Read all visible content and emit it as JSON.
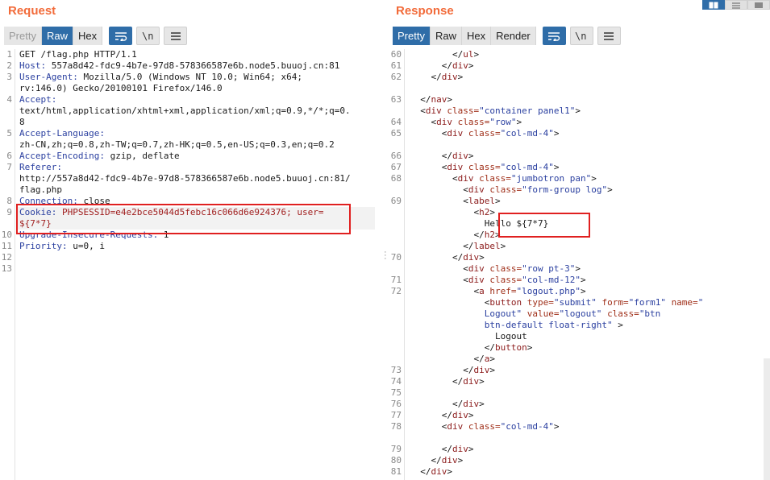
{
  "request": {
    "title": "Request",
    "tabs": [
      "Pretty",
      "Raw",
      "Hex"
    ],
    "active_tab": "Raw",
    "lines": [
      {
        "n": "1",
        "text": "GET /flag.php HTTP/1.1"
      },
      {
        "n": "2",
        "key": "Host:",
        "val": " 557a8d42-fdc9-4b7e-97d8-578366587e6b.node5.buuoj.cn:81"
      },
      {
        "n": "3",
        "key": "User-Agent:",
        "val": " Mozilla/5.0 (Windows NT 10.0; Win64; x64;"
      },
      {
        "n": "",
        "text": "rv:146.0) Gecko/20100101 Firefox/146.0"
      },
      {
        "n": "4",
        "key": "Accept:",
        "val": ""
      },
      {
        "n": "",
        "text": "text/html,application/xhtml+xml,application/xml;q=0.9,*/*;q=0."
      },
      {
        "n": "",
        "text": "8"
      },
      {
        "n": "5",
        "key": "Accept-Language:",
        "val": ""
      },
      {
        "n": "",
        "text": "zh-CN,zh;q=0.8,zh-TW;q=0.7,zh-HK;q=0.5,en-US;q=0.3,en;q=0.2"
      },
      {
        "n": "6",
        "key": "Accept-Encoding:",
        "val": " gzip, deflate"
      },
      {
        "n": "7",
        "key": "Referer:",
        "val": ""
      },
      {
        "n": "",
        "text": "http://557a8d42-fdc9-4b7e-97d8-578366587e6b.node5.buuoj.cn:81/"
      },
      {
        "n": "",
        "text": "flag.php"
      },
      {
        "n": "8",
        "key": "Connection:",
        "val": " close"
      },
      {
        "n": "9",
        "key": "Cookie:",
        "val": " PHPSESSID=e4e2bce5044d5febc16c066d6e924376; user="
      },
      {
        "n": "",
        "text": "${7*7}",
        "cls": "v"
      },
      {
        "n": "10",
        "key": "Upgrade-Insecure-Requests:",
        "val": " 1"
      },
      {
        "n": "11",
        "key": "Priority:",
        "val": " u=0, i"
      },
      {
        "n": "12",
        "text": ""
      },
      {
        "n": "13",
        "text": ""
      }
    ]
  },
  "response": {
    "title": "Response",
    "tabs": [
      "Pretty",
      "Raw",
      "Hex",
      "Render"
    ],
    "active_tab": "Pretty",
    "lines": [
      {
        "n": "60",
        "html": "        &lt;/ul&gt;"
      },
      {
        "n": "61",
        "html": "      &lt;/div&gt;"
      },
      {
        "n": "62",
        "html": "    &lt;/div&gt;"
      },
      {
        "n": "",
        "html": ""
      },
      {
        "n": "63",
        "html": "  &lt;/nav&gt;"
      },
      {
        "n": "",
        "html": "  &lt;div <a>class=</a><s>\"container panel1\"</s>&gt;"
      },
      {
        "n": "64",
        "html": "    &lt;div <a>class=</a><s>\"row\"</s>&gt;"
      },
      {
        "n": "65",
        "html": "      &lt;div <a>class=</a><s>\"col-md-4\"</s>&gt;"
      },
      {
        "n": "",
        "html": ""
      },
      {
        "n": "66",
        "html": "      &lt;/div&gt;"
      },
      {
        "n": "67",
        "html": "      &lt;div <a>class=</a><s>\"col-md-4\"</s>&gt;"
      },
      {
        "n": "68",
        "html": "        &lt;div <a>class=</a><s>\"jumbotron pan\"</s>&gt;"
      },
      {
        "n": "",
        "html": "          &lt;div <a>class=</a><s>\"form-group log\"</s>&gt;"
      },
      {
        "n": "69",
        "html": "          &lt;label&gt;"
      },
      {
        "n": "",
        "html": "            &lt;h2&gt;"
      },
      {
        "n": "",
        "html": "              Hello ${7*7}"
      },
      {
        "n": "",
        "html": "            &lt;/h2&gt;"
      },
      {
        "n": "",
        "html": "          &lt;/label&gt;"
      },
      {
        "n": "70",
        "html": "        &lt;/div&gt;"
      },
      {
        "n": "",
        "html": "          &lt;div <a>class=</a><s>\"row pt-3\"</s>&gt;"
      },
      {
        "n": "71",
        "html": "          &lt;div <a>class=</a><s>\"col-md-12\"</s>&gt;"
      },
      {
        "n": "72",
        "html": "            &lt;a <a>href=</a><s>\"logout.php\"</s>&gt;"
      },
      {
        "n": "",
        "html": "              &lt;button <a>type=</a><s>\"submit\"</s> <a>form=</a><s>\"form1\"</s> <a>name=</a><s>\"</s>"
      },
      {
        "n": "",
        "html": "              <s>Logout\"</s> <a>value=</a><s>\"logout\"</s> <a>class=</a><s>\"btn</s>"
      },
      {
        "n": "",
        "html": "              <s>btn-default float-right\"</s> &gt;"
      },
      {
        "n": "",
        "html": "                Logout"
      },
      {
        "n": "",
        "html": "              &lt;/button&gt;"
      },
      {
        "n": "",
        "html": "            &lt;/a&gt;"
      },
      {
        "n": "73",
        "html": "          &lt;/div&gt;"
      },
      {
        "n": "74",
        "html": "        &lt;/div&gt;"
      },
      {
        "n": "75",
        "html": ""
      },
      {
        "n": "76",
        "html": "        &lt;/div&gt;"
      },
      {
        "n": "77",
        "html": "      &lt;/div&gt;"
      },
      {
        "n": "78",
        "html": "      &lt;div <a>class=</a><s>\"col-md-4\"</s>&gt;"
      },
      {
        "n": "",
        "html": ""
      },
      {
        "n": "79",
        "html": "      &lt;/div&gt;"
      },
      {
        "n": "80",
        "html": "    &lt;/div&gt;"
      },
      {
        "n": "81",
        "html": "  &lt;/div&gt;"
      }
    ]
  },
  "colors": {
    "accent": "#f26b3a",
    "active_tab": "#2f6da8",
    "highlight_box": "#e02020"
  },
  "icons": [
    "wrap-icon",
    "newline-icon",
    "menu-icon",
    "layout-split-icon",
    "layout-horizontal-icon",
    "layout-single-icon"
  ]
}
